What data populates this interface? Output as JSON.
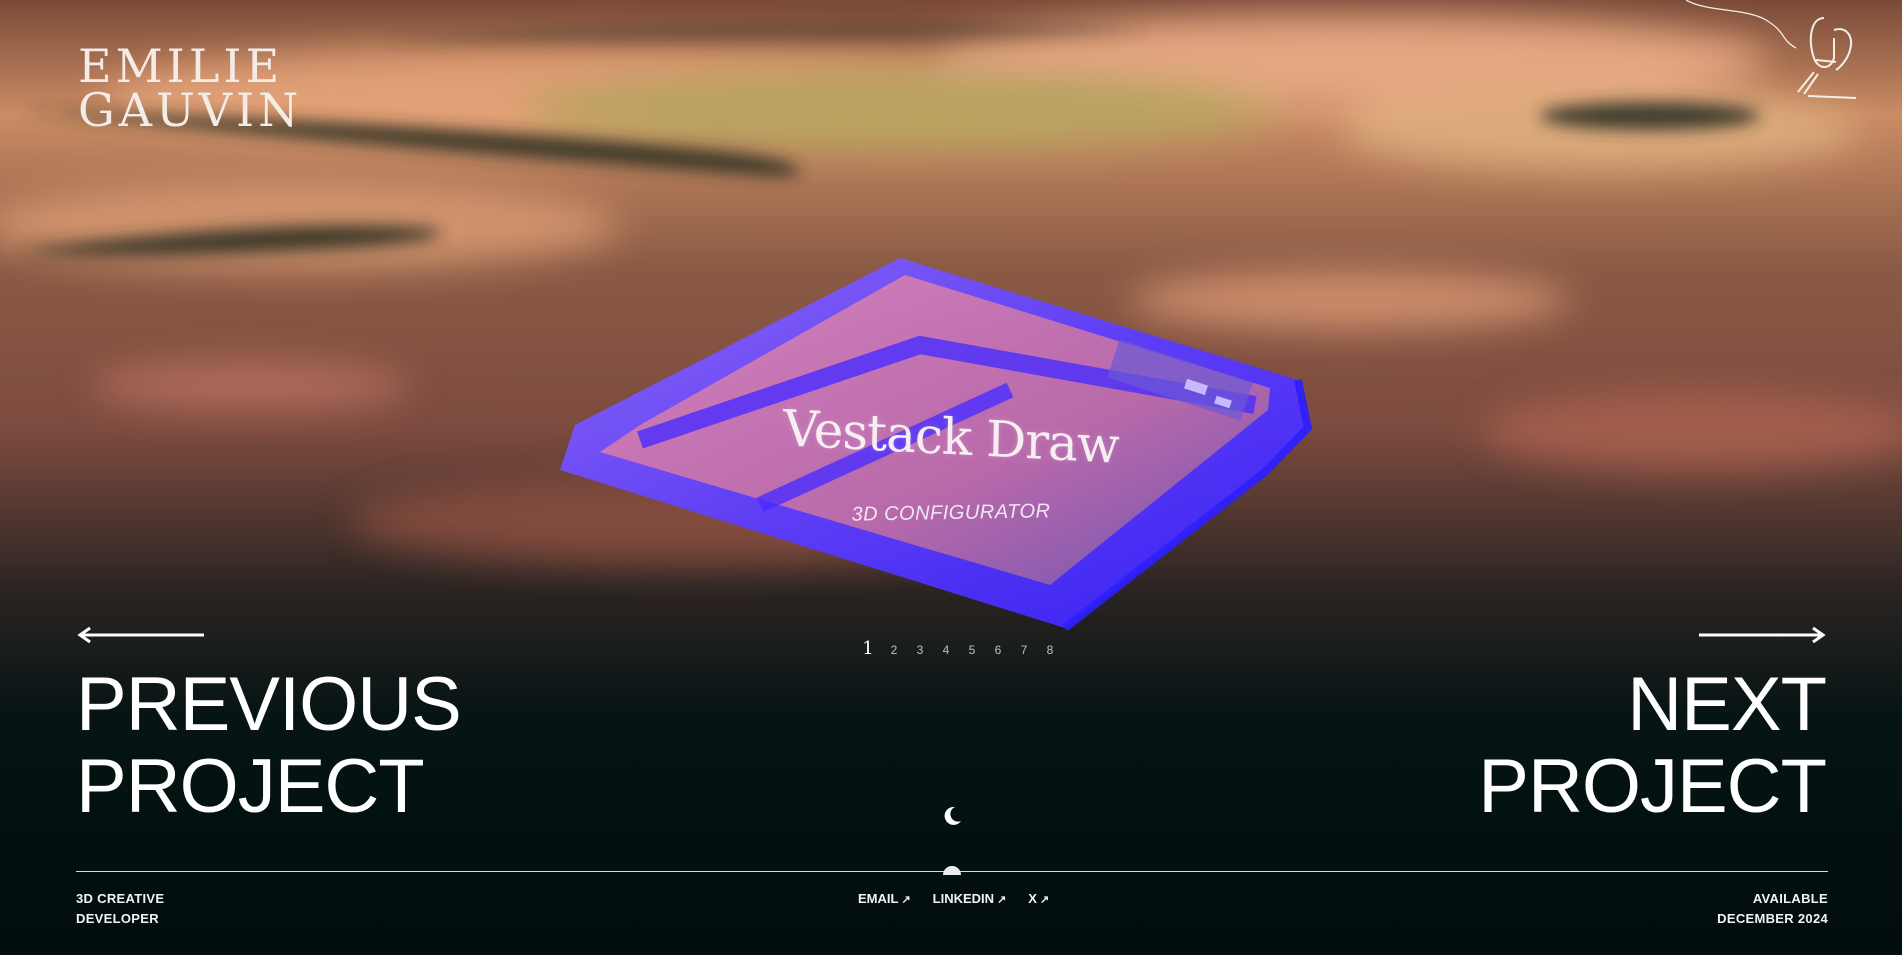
{
  "brand": {
    "name_line1": "EMILIE",
    "name_line2": "GAUVIN"
  },
  "project": {
    "title": "Vestack Draw",
    "subtitle": "3D CONFIGURATOR"
  },
  "pagination": {
    "pages": [
      "1",
      "2",
      "3",
      "4",
      "5",
      "6",
      "7",
      "8"
    ],
    "current": "1"
  },
  "nav": {
    "previous_line1": "PREVIOUS",
    "previous_line2": "PROJECT",
    "next_line1": "NEXT",
    "next_line2": "PROJECT"
  },
  "footer": {
    "role_line1": "3D CREATIVE",
    "role_line2": "DEVELOPER",
    "links": [
      {
        "label": "EMAIL",
        "icon": "external-arrow-icon"
      },
      {
        "label": "LINKEDIN",
        "icon": "external-arrow-icon"
      },
      {
        "label": "X",
        "icon": "external-arrow-icon"
      }
    ],
    "availability_line1": "AVAILABLE",
    "availability_line2": "DECEMBER 2024"
  },
  "icons": {
    "theme_toggle": "moon-icon",
    "logo_mark": "signature-mark-icon",
    "prev_arrow": "arrow-left-icon",
    "next_arrow": "arrow-right-icon"
  },
  "colors": {
    "device": "#5a3bff",
    "background_dark": "#03100f",
    "warm_tone": "#e8a074",
    "text": "#ffffff"
  }
}
